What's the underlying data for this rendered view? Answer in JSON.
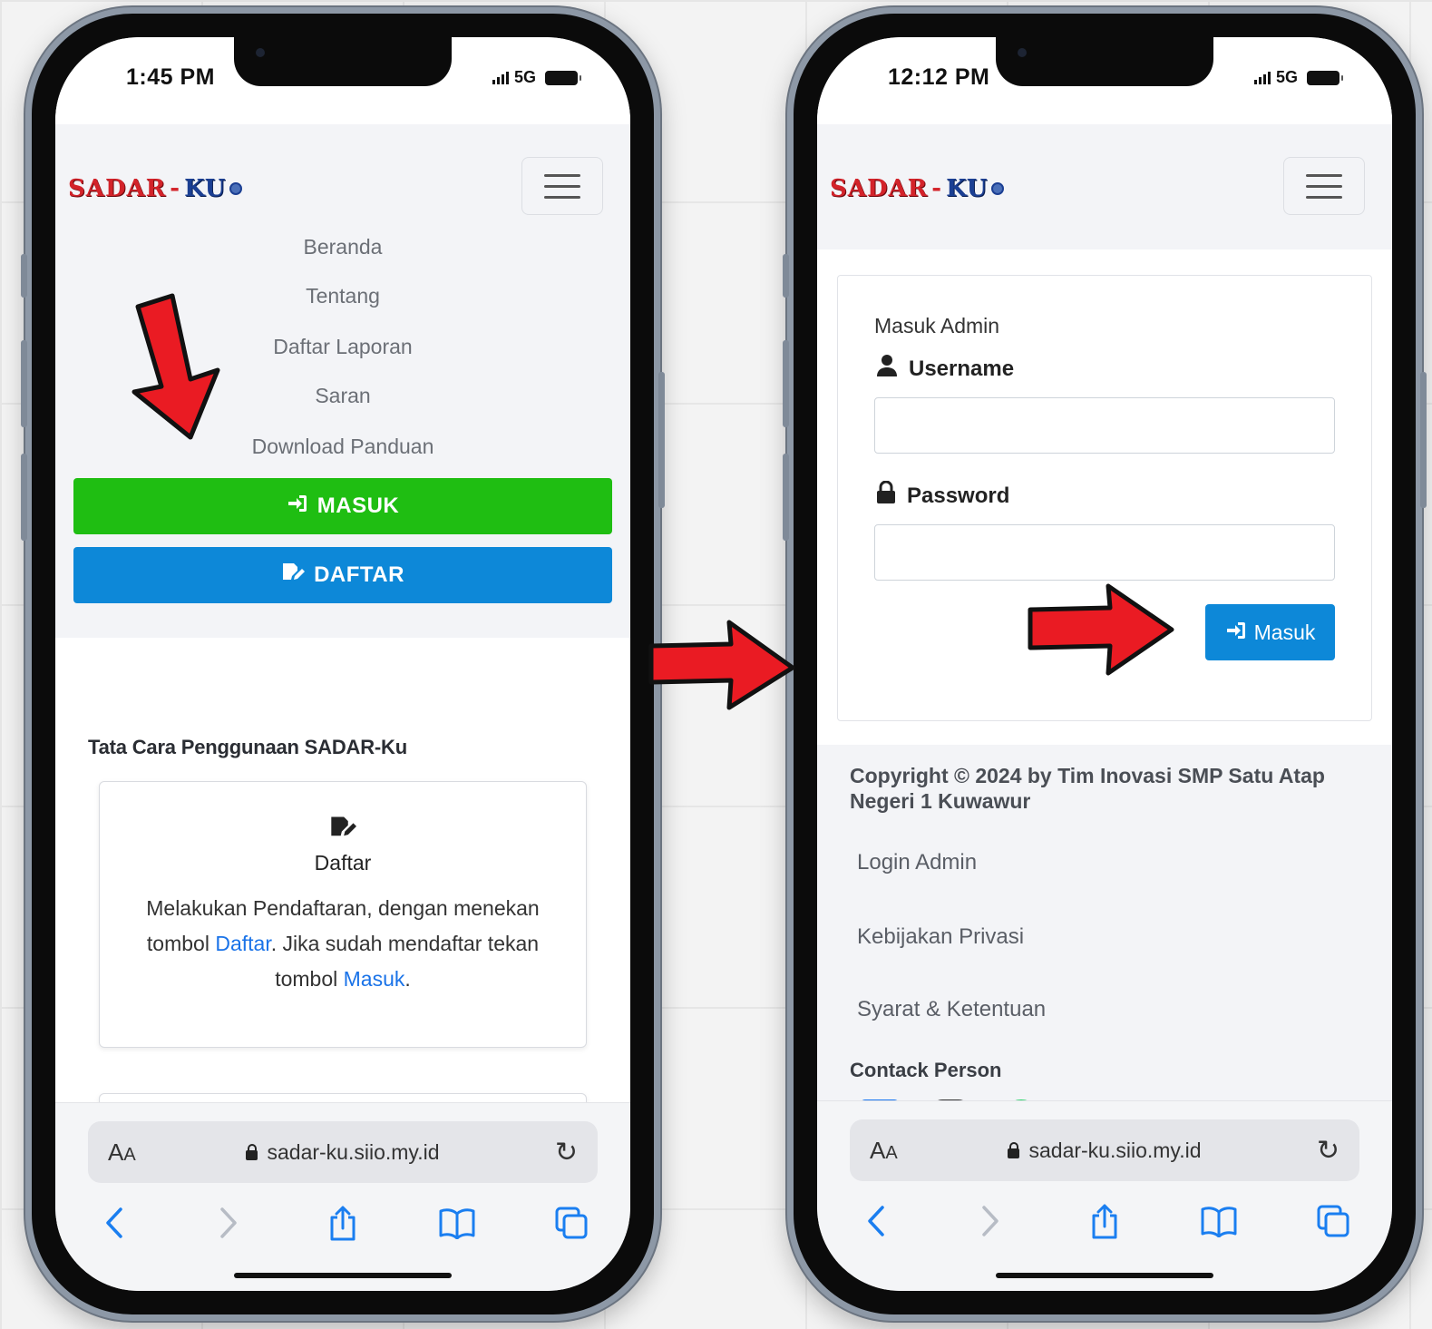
{
  "left_phone": {
    "status": {
      "time": "1:45 PM",
      "network": "5G"
    },
    "logo": {
      "part1": "SADAR",
      "dash": "-",
      "part2": "KU"
    },
    "menu": [
      "Beranda",
      "Tentang",
      "Daftar Laporan",
      "Saran",
      "Download Panduan"
    ],
    "buttons": {
      "login": "MASUK",
      "register": "DAFTAR"
    },
    "section_title": "Tata Cara Penggunaan SADAR-Ku",
    "card": {
      "title": "Daftar",
      "text_1": "Melakukan Pendaftaran, dengan menekan tombol ",
      "link_1": "Daftar",
      "text_2": ". Jika sudah mendaftar tekan tombol ",
      "link_2": "Masuk",
      "text_3": "."
    },
    "browser": {
      "aa_big": "A",
      "aa_small": "A",
      "url": "sadar-ku.siio.my.id"
    }
  },
  "right_phone": {
    "status": {
      "time": "12:12 PM",
      "network": "5G"
    },
    "logo": {
      "part1": "SADAR",
      "dash": "-",
      "part2": "KU"
    },
    "login": {
      "heading": "Masuk Admin",
      "username_label": "Username",
      "password_label": "Password",
      "username_value": "",
      "password_value": "",
      "submit": "Masuk"
    },
    "footer": {
      "copyright": "Copyright © 2024 by Tim Inovasi SMP Satu Atap Negeri 1 Kuwawur",
      "links": [
        "Login Admin",
        "Kebijakan Privasi",
        "Syarat & Ketentuan"
      ],
      "contact_title": "Contack Person"
    },
    "browser": {
      "aa_big": "A",
      "aa_small": "A",
      "url": "sadar-ku.siio.my.id"
    }
  },
  "colors": {
    "green": "#1fbe12",
    "blue": "#0d88d8",
    "logo_red": "#d3232a",
    "logo_blue": "#1b3f93",
    "arrow_red": "#ea1b23",
    "safari_blue": "#1a7ef0"
  },
  "icons": [
    "sign-in-icon",
    "edit-icon",
    "user-icon",
    "lock-icon",
    "reload-icon",
    "back-icon",
    "forward-icon",
    "share-icon",
    "bookmarks-icon",
    "tabs-icon",
    "facebook-icon",
    "instagram-icon",
    "whatsapp-icon"
  ]
}
